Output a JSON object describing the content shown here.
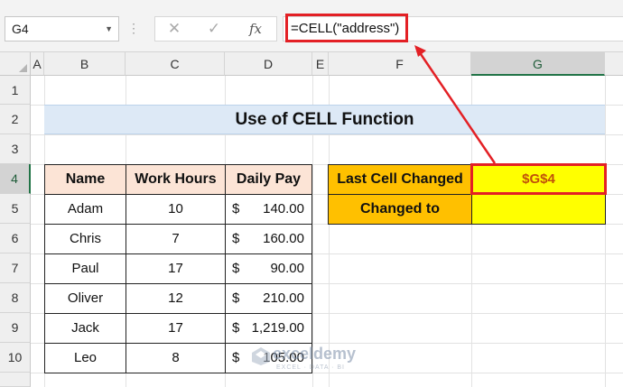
{
  "formula_bar": {
    "name_box": "G4",
    "dots": "⋮",
    "cancel": "✕",
    "enter": "✓",
    "fx": "fx",
    "formula": "=CELL(\"address\")"
  },
  "columns": [
    "A",
    "B",
    "C",
    "D",
    "E",
    "F",
    "G"
  ],
  "rows": [
    "1",
    "2",
    "3",
    "4",
    "5",
    "6",
    "7",
    "8",
    "9",
    "10"
  ],
  "title": "Use of CELL Function",
  "table": {
    "headers": [
      "Name",
      "Work Hours",
      "Daily Pay"
    ],
    "rows": [
      {
        "name": "Adam",
        "hours": "10",
        "cur": "$",
        "pay": "140.00"
      },
      {
        "name": "Chris",
        "hours": "7",
        "cur": "$",
        "pay": "160.00"
      },
      {
        "name": "Paul",
        "hours": "17",
        "cur": "$",
        "pay": "90.00"
      },
      {
        "name": "Oliver",
        "hours": "12",
        "cur": "$",
        "pay": "210.00"
      },
      {
        "name": "Jack",
        "hours": "17",
        "cur": "$",
        "pay": "1,219.00"
      },
      {
        "name": "Leo",
        "hours": "8",
        "cur": "$",
        "pay": "105.00"
      }
    ]
  },
  "info": {
    "last_cell_label": "Last Cell Changed",
    "last_cell_value": "$G$4",
    "changed_to_label": "Changed to",
    "changed_to_value": ""
  },
  "watermark": {
    "name": "exceldemy",
    "sub": "EXCEL · DATA · BI"
  },
  "colors": {
    "header_fill": "#fce4d6",
    "title_fill": "#dde9f6",
    "orange_fill": "#ffc000",
    "yellow_fill": "#ffff00",
    "highlight_red": "#e32025"
  }
}
